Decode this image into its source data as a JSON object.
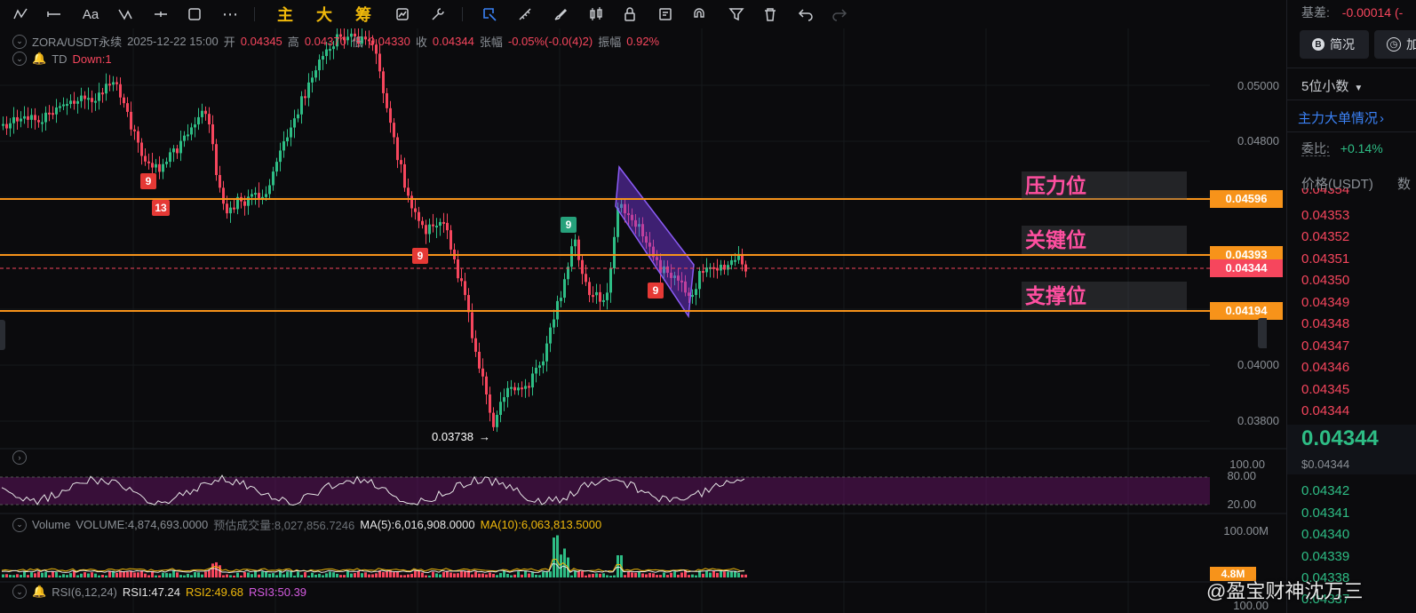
{
  "toolbar": {
    "text_buttons": [
      "主",
      "大",
      "筹"
    ],
    "icons": [
      "trend-line-icon",
      "horizontal-line-icon",
      "text-icon",
      "fib-icon",
      "ray-icon",
      "rectangle-icon",
      "more-icon",
      "indicator-icon",
      "wrench-icon",
      "select-icon",
      "measure-icon",
      "brush-icon",
      "candle-icon",
      "lock-icon",
      "note-icon",
      "magnet-icon",
      "filter-icon",
      "trash-icon",
      "undo-icon",
      "redo-icon"
    ]
  },
  "legend": {
    "symbol": "ZORA/USDT永续",
    "datetime": "2025-12-22 15:00",
    "open_label": "开",
    "open": "0.04345",
    "high_label": "高",
    "high": "0.04370",
    "low_label": "低",
    "low": "0.04330",
    "close_label": "收",
    "close": "0.04344",
    "change_label": "张幅",
    "change": "-0.05%(-0.0(4)2)",
    "amp_label": "振幅",
    "amp": "0.92%",
    "td_name": "TD",
    "td_value": "Down:1"
  },
  "price_axis": [
    "0.05000",
    "0.04800",
    "0.04000",
    "0.03800"
  ],
  "price_tags": {
    "pressure": "0.04596",
    "key": "0.04393",
    "current": "0.04344",
    "support": "0.04194"
  },
  "zones": {
    "pressure": "压力位",
    "key": "关键位",
    "support": "支撑位"
  },
  "low_marker": "0.03738",
  "td_badges": {
    "b1": "9",
    "b2": "13",
    "b3": "9",
    "b4": "9",
    "b5": "9"
  },
  "rsi_axis": {
    "top": "100.00",
    "upper": "80.00",
    "lower": "20.00"
  },
  "volume_legend": {
    "name": "Volume",
    "volume": "VOLUME:4,874,693.0000",
    "est": "预估成交量:8,027,856.7246",
    "ma5": "MA(5):6,016,908.0000",
    "ma10": "MA(10):6,063,813.5000",
    "axis_top": "100.00M",
    "axis_mid": "4.8M"
  },
  "rsi_legend": {
    "name": "RSI(6,12,24)",
    "rsi1": "RSI1:47.24",
    "rsi2": "RSI2:49.68",
    "rsi3": "RSI3:50.39",
    "axis": "100.00"
  },
  "panel": {
    "basis_label": "基差:",
    "basis_value": "-0.00014 (-",
    "btn_brief": "简况",
    "btn_add": "加",
    "decimals": "5位小数",
    "big_orders": "主力大单情况",
    "ratio_label": "委比:",
    "ratio_value": "+0.14%",
    "price_header": "价格(USDT)",
    "qty_header": "数",
    "asks": [
      "0.04354",
      "0.04353",
      "0.04352",
      "0.04351",
      "0.04350",
      "0.04349",
      "0.04348",
      "0.04347",
      "0.04346",
      "0.04345",
      "0.04344"
    ],
    "last_price": "0.04344",
    "last_usd": "$0.04344",
    "bids": [
      "0.04342",
      "0.04341",
      "0.04340",
      "0.04339",
      "0.04338",
      "0.04337"
    ]
  },
  "watermark": "@盈宝财神沈万三",
  "colors": {
    "up": "#2ebd85",
    "down": "#f6465d",
    "orange": "#f7931a",
    "magenta": "#ff4fa0"
  }
}
